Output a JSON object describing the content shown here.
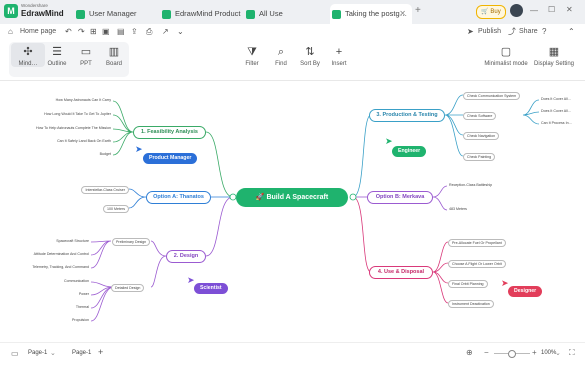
{
  "app": {
    "brand_small": "Wondershare",
    "brand": "EdrawMind"
  },
  "tabs": [
    {
      "label": "User Manager"
    },
    {
      "label": "EdrawMind Product"
    },
    {
      "label": "All Use"
    },
    {
      "label": "Taking the postg…"
    }
  ],
  "header": {
    "buy": "Buy",
    "home": "Home page",
    "publish": "Publish",
    "share": "Share"
  },
  "ribbon": {
    "mind": "Mind…",
    "outline": "Outline",
    "ppt": "PPT",
    "board": "Board",
    "filter": "Filter",
    "find": "Find",
    "sortby": "Sort By",
    "insert": "Insert",
    "minimalist": "Minimalist mode",
    "display": "Display Setting"
  },
  "map": {
    "central": "Build A Spacecraft",
    "branches": {
      "b1": "1. Feasibility Analysis",
      "bA": "Option A: Thanatos",
      "b2": "2. Design",
      "b3": "3. Production & Testing",
      "bB": "Option B: Merkava",
      "b4": "4. Use & Disposal"
    },
    "b1_leaves": [
      "How Many Astronauts Can It Carry",
      "How Long Would It Take To Get To Jupiter",
      "How To Help Astronauts Complete The Mission",
      "Can It Safely Land Back On Earth",
      "Budget"
    ],
    "bA_leaves": [
      "Interstellar-Class Cruiser",
      "100 Meters"
    ],
    "b2_sub": [
      "Preliminary Design",
      "Detailed Design"
    ],
    "b2_pre": [
      "Spacecraft Structure",
      "Attitude Determination And Control",
      "Telemetry, Tracking, And Command"
    ],
    "b2_det": [
      "Communication",
      "Power",
      "Thermal",
      "Propulsion"
    ],
    "b3_leaves": [
      "Check Communication System",
      "Check Software",
      "Check Navigation",
      "Check Painting"
    ],
    "b3_sw": [
      "Does It Cover All…",
      "Does It Cover All…",
      "Can It Process In…"
    ],
    "bB_leaves": [
      "Reception-Class Battleship",
      "483 Meters"
    ],
    "b4_leaves": [
      "Pre-Allocate Fuel Or Propellant",
      "Choose A Flight Or Lower Orbit",
      "Final Orbit Planning",
      "Instrument Deactivation"
    ],
    "badges": {
      "pm": "Product Manager",
      "engineer": "Engineer",
      "scientist": "Scientist",
      "designer": "Designer"
    }
  },
  "status": {
    "page_sel": "Page-1",
    "page_tab": "Page-1",
    "zoom": "100%"
  },
  "colors": {
    "central": "#1fb36e",
    "b1": "#3aaa67",
    "bA": "#2f7fd6",
    "b2": "#9b5bd1",
    "b3": "#3aa0c7",
    "bB": "#9b5bd1",
    "b4": "#d9397a",
    "pm": "#2b6fd8",
    "engineer": "#1fb36e",
    "scientist": "#7d4fd6",
    "designer": "#e23d5a"
  }
}
